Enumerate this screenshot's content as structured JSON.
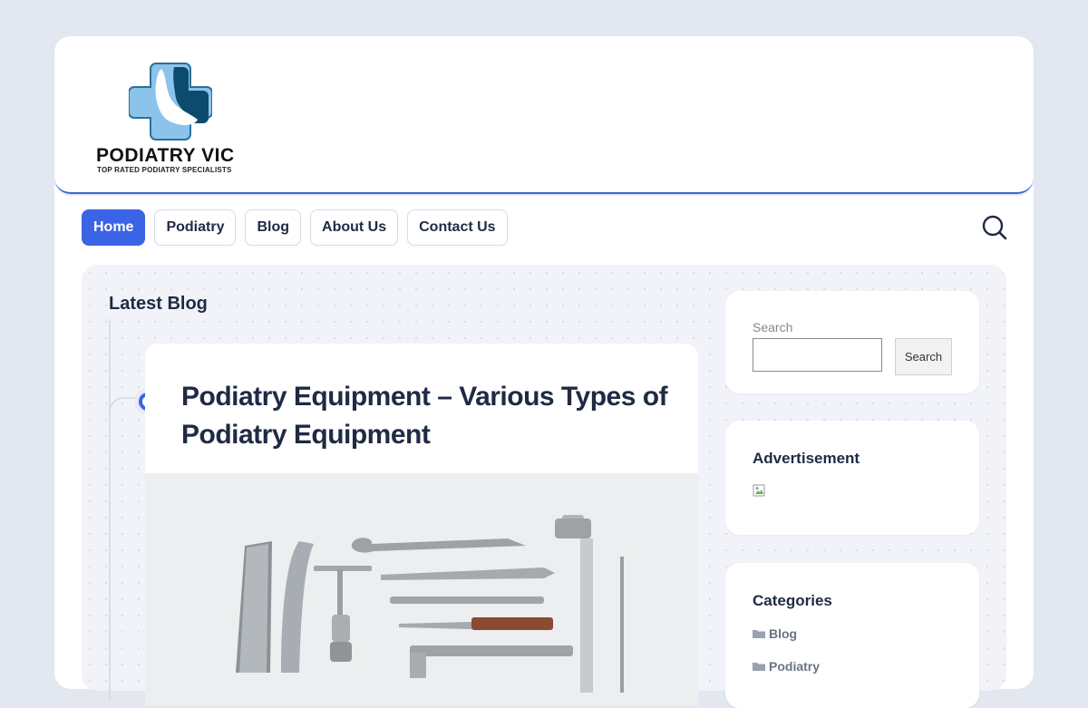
{
  "brand": {
    "name": "PODIATRY VIC",
    "tagline": "TOP RATED PODIATRY SPECIALISTS",
    "accent": "#3b63e6"
  },
  "nav": {
    "items": [
      {
        "label": "Home",
        "active": true
      },
      {
        "label": "Podiatry",
        "active": false
      },
      {
        "label": "Blog",
        "active": false
      },
      {
        "label": "About Us",
        "active": false
      },
      {
        "label": "Contact Us",
        "active": false
      }
    ],
    "search_icon": "search-icon"
  },
  "main": {
    "section_title": "Latest Blog",
    "post": {
      "title": "Podiatry Equipment – Various Types of Podiatry Equipment"
    }
  },
  "sidebar": {
    "search": {
      "label": "Search",
      "button_label": "Search",
      "value": ""
    },
    "advertisement": {
      "title": "Advertisement"
    },
    "categories": {
      "title": "Categories",
      "items": [
        "Blog",
        "Podiatry"
      ]
    }
  }
}
